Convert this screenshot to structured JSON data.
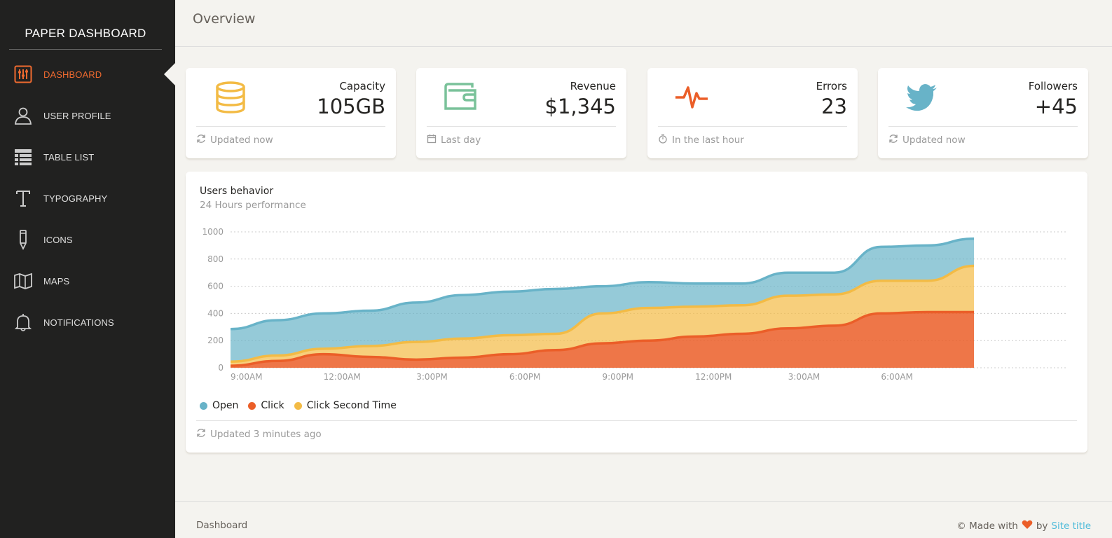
{
  "brand": "PAPER DASHBOARD",
  "sidebar": {
    "items": [
      {
        "label": "DASHBOARD",
        "icon": "sliders-icon"
      },
      {
        "label": "USER PROFILE",
        "icon": "user-icon"
      },
      {
        "label": "TABLE LIST",
        "icon": "table-list-icon"
      },
      {
        "label": "TYPOGRAPHY",
        "icon": "text-icon"
      },
      {
        "label": "ICONS",
        "icon": "pencil-icon"
      },
      {
        "label": "MAPS",
        "icon": "map-icon"
      },
      {
        "label": "NOTIFICATIONS",
        "icon": "bell-icon"
      }
    ],
    "active": "DASHBOARD"
  },
  "header": {
    "title": "Overview"
  },
  "stats": [
    {
      "label": "Capacity",
      "value": "105GB",
      "footer": "Updated now",
      "icon": "database-icon",
      "footer_icon": "refresh-icon",
      "color": "#f3bb45"
    },
    {
      "label": "Revenue",
      "value": "$1,345",
      "footer": "Last day",
      "icon": "wallet-icon",
      "footer_icon": "calendar-icon",
      "color": "#7ac29a"
    },
    {
      "label": "Errors",
      "value": "23",
      "footer": "In the last hour",
      "icon": "pulse-icon",
      "footer_icon": "timer-icon",
      "color": "#eb5e28"
    },
    {
      "label": "Followers",
      "value": "+45",
      "footer": "Updated now",
      "icon": "twitter-icon",
      "footer_icon": "refresh-icon",
      "color": "#68b3c8"
    }
  ],
  "chart": {
    "title": "Users behavior",
    "subtitle": "24 Hours performance",
    "footer": "Updated 3 minutes ago"
  },
  "chart_data": {
    "type": "area",
    "stacked": true,
    "x": [
      "9:00AM",
      "",
      "12:00AM",
      "",
      "3:00PM",
      "",
      "6:00PM",
      "",
      "9:00PM",
      "",
      "12:00PM",
      "",
      "3:00AM",
      "",
      "6:00AM",
      "",
      ""
    ],
    "tick_labels": [
      "9:00AM",
      "12:00AM",
      "3:00PM",
      "6:00PM",
      "9:00PM",
      "12:00PM",
      "3:00AM",
      "6:00AM"
    ],
    "series": [
      {
        "name": "Click",
        "color": "#eb5e28",
        "values": [
          15,
          50,
          100,
          80,
          60,
          75,
          100,
          130,
          180,
          200,
          230,
          250,
          290,
          310,
          400,
          410,
          410
        ]
      },
      {
        "name": "Click Second Time",
        "color": "#f3bb45",
        "values": [
          30,
          40,
          40,
          80,
          130,
          140,
          140,
          120,
          220,
          240,
          220,
          210,
          240,
          230,
          240,
          230,
          340
        ]
      },
      {
        "name": "Open",
        "color": "#68b3c8",
        "values": [
          240,
          260,
          260,
          260,
          290,
          320,
          320,
          330,
          200,
          190,
          170,
          160,
          170,
          160,
          250,
          260,
          200
        ]
      }
    ],
    "ylim": [
      0,
      1000
    ],
    "yticks": [
      0,
      200,
      400,
      600,
      800,
      1000
    ],
    "grid": true,
    "legend": "bottom-left"
  },
  "footer": {
    "left": "Dashboard",
    "made_with": "© Made with",
    "by": "by",
    "site_title": "Site title",
    "heart_color": "#eb5e28"
  }
}
